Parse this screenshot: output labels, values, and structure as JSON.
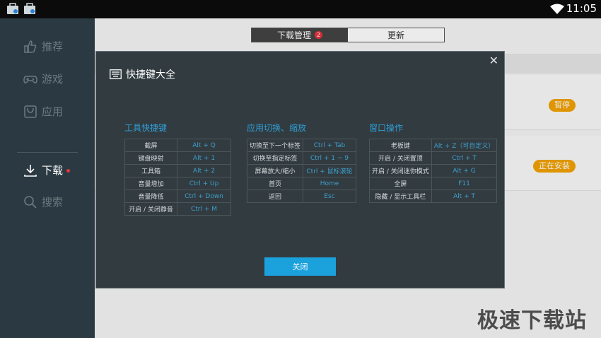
{
  "statusbar": {
    "time": "11:05"
  },
  "sidebar": {
    "items": [
      {
        "label": "推荐",
        "icon": "thumbs-up-icon"
      },
      {
        "label": "游戏",
        "icon": "gamepad-icon"
      },
      {
        "label": "应用",
        "icon": "bag-icon"
      },
      {
        "label": "下载",
        "icon": "download-icon"
      },
      {
        "label": "搜索",
        "icon": "search-icon"
      }
    ]
  },
  "tabs": {
    "download_manager": "下载管理",
    "badge": "2",
    "update": "更新"
  },
  "rows": [
    {
      "status": "暂停"
    },
    {
      "status": "正在安装"
    }
  ],
  "dialog": {
    "title": "快捷键大全",
    "close_label": "关闭",
    "sections": [
      {
        "title": "工具快捷键",
        "rows": [
          [
            "截屏",
            "Alt + Q"
          ],
          [
            "键盘映射",
            "Alt + 1"
          ],
          [
            "工具箱",
            "Alt + 2"
          ],
          [
            "音量增加",
            "Ctrl + Up"
          ],
          [
            "音量降低",
            "Ctrl + Down"
          ],
          [
            "开启 / 关闭静音",
            "Ctrl + M"
          ]
        ]
      },
      {
        "title": "应用切换、缩放",
        "rows": [
          [
            "切换至下一个标签",
            "Ctrl + Tab"
          ],
          [
            "切换至指定标签",
            "Ctrl + 1 ~ 9"
          ],
          [
            "屏幕放大/缩小",
            "Ctrl + 鼠标滚轮"
          ],
          [
            "首页",
            "Home"
          ],
          [
            "返回",
            "Esc"
          ]
        ]
      },
      {
        "title": "窗口操作",
        "rows": [
          [
            "老板键",
            "Alt + Z（可自定义）"
          ],
          [
            "开启 / 关闭置顶",
            "Ctrl + T"
          ],
          [
            "开启 / 关闭迷你模式",
            "Alt + G"
          ],
          [
            "全屏",
            "F11"
          ],
          [
            "隐藏 / 显示工具栏",
            "Alt + T"
          ]
        ]
      }
    ]
  },
  "watermark": "极速下载站"
}
